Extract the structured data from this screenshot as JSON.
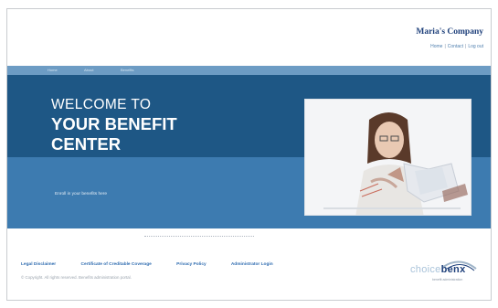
{
  "header": {
    "company": "Maria's Company",
    "links": [
      "Home",
      "Contact",
      "Log out"
    ]
  },
  "strip": {
    "items": [
      "Home",
      "About",
      "Benefits"
    ]
  },
  "hero": {
    "line1": "WELCOME TO",
    "line2": "YOUR BENEFIT",
    "line3": "CENTER",
    "caption": "Enroll in your benefits here"
  },
  "footer": {
    "links": [
      "Legal Disclaimer",
      "Certificate of Creditable Coverage",
      "Privacy Policy",
      "Administrator Login"
    ],
    "copyright": "© Copyright. All rights reserved. Benefits administration portal."
  },
  "logo": {
    "light": "choice",
    "dark": "benx",
    "tag": "benefit administration"
  },
  "colors": {
    "hero_dark": "#1e5785",
    "hero_light": "#3d7bb0",
    "strip": "#6d9cc4",
    "company": "#1d3f7a",
    "link": "#2f6cb0"
  }
}
